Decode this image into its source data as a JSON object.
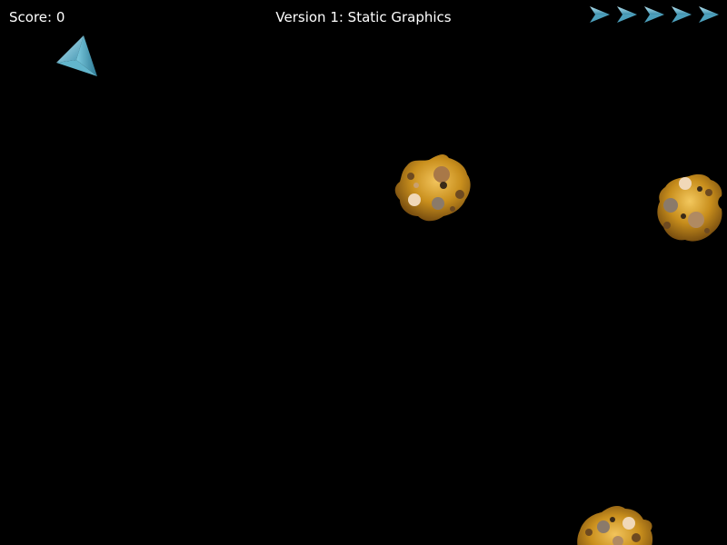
{
  "hud": {
    "score_text": "Score: 0",
    "title": "Version 1: Static Graphics",
    "lives_remaining": 5
  },
  "icons": {
    "life": "ship-life-icon",
    "ship": "player-ship-icon",
    "asteroid": "asteroid-icon"
  },
  "colors": {
    "background": "#000000",
    "hud_text": "#ffffff",
    "ship": "#5fb8d0",
    "asteroid": "#c8921e"
  }
}
